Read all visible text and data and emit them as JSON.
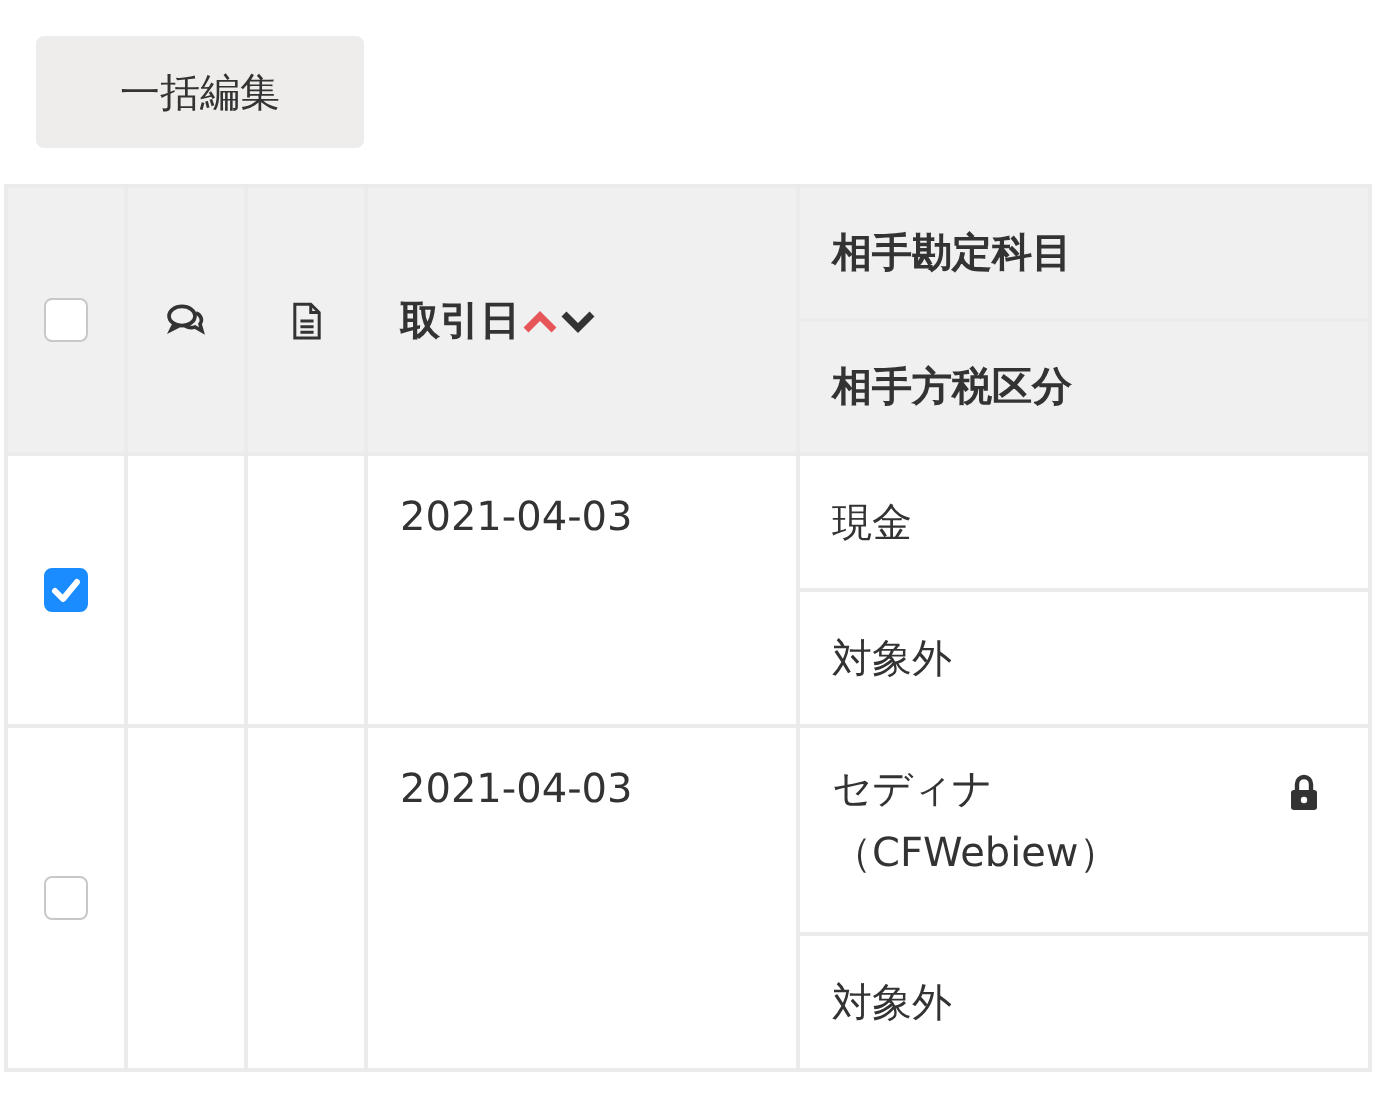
{
  "bulk_edit_button": "一括編集",
  "header": {
    "select_all_checked": false,
    "date_label": "取引日",
    "sort_up_active": true,
    "sort_down_active": false,
    "account_label": "相手勘定科目",
    "tax_label": "相手方税区分"
  },
  "rows": [
    {
      "selected": true,
      "date": "2021-04-03",
      "account": "現金",
      "locked": false,
      "tax": "対象外"
    },
    {
      "selected": false,
      "date": "2021-04-03",
      "account": "セディナ（CFWebiew）",
      "locked": true,
      "tax": "対象外"
    }
  ]
}
